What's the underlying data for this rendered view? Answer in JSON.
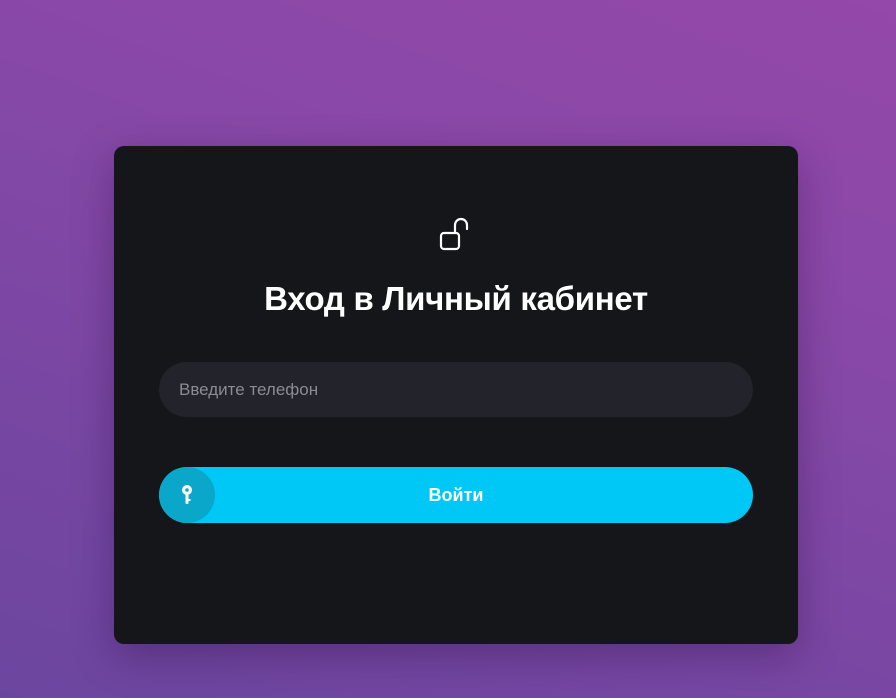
{
  "colors": {
    "background_gradient": [
      "#9448a9",
      "#6b469f"
    ],
    "card_background": "#151619",
    "input_background": "#22232b",
    "button_accent": "#00c8f6",
    "button_icon_circle": "#0aa7cb",
    "text": "#ffffff"
  },
  "login": {
    "icon": "unlock-icon",
    "title": "Вход в Личный кабинет",
    "phone_input": {
      "placeholder": "Введите телефон",
      "value": ""
    },
    "submit": {
      "icon": "key-icon",
      "label": "Войти"
    }
  }
}
